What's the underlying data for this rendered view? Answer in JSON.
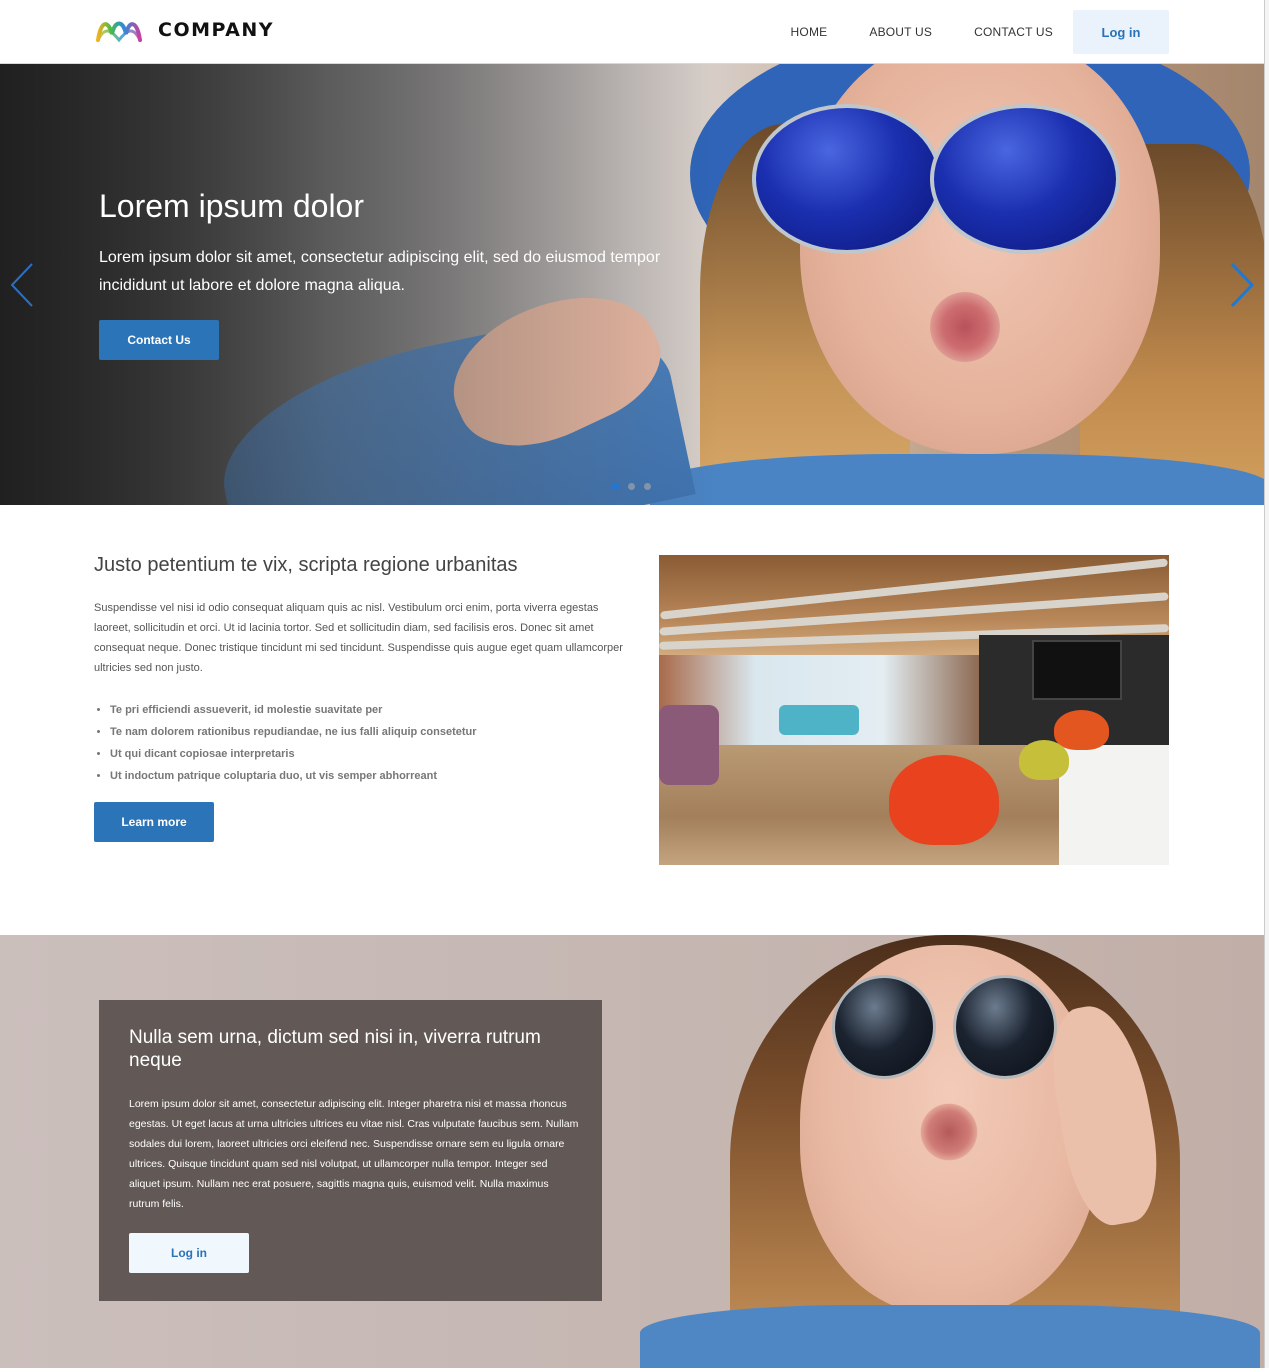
{
  "header": {
    "logo_text": "COMPANY",
    "nav": [
      "HOME",
      "ABOUT US",
      "CONTACT US"
    ],
    "login_label": "Log in"
  },
  "hero": {
    "title": "Lorem ipsum dolor",
    "text": "Lorem ipsum dolor sit amet, consectetur adipiscing elit, sed do eiusmod tempor incididunt ut labore et dolore magna aliqua.",
    "button_label": "Contact Us",
    "slide_count": 3,
    "active_slide": 1
  },
  "feature": {
    "title": "Justo petentium te vix, scripta regione urbanitas",
    "text": "Suspendisse vel nisi id odio consequat aliquam quis ac nisl. Vestibulum orci enim, porta viverra egestas laoreet, sollicitudin et orci. Ut id lacinia tortor. Sed et sollicitudin diam, sed facilisis eros. Donec sit amet consequat neque. Donec tristique tincidunt mi sed tincidunt. Suspendisse quis augue eget quam ullamcorper ultricies sed non justo.",
    "list": [
      "Te pri efficiendi assueverit, id molestie suavitate per",
      "Te nam dolorem rationibus repudiandae, ne ius falli aliquip consetetur",
      "Ut qui dicant copiosae interpretaris",
      "Ut indoctum patrique coluptaria duo, ut vis semper abhorreant"
    ],
    "button_label": "Learn more"
  },
  "banner": {
    "title": "Nulla sem urna, dictum sed nisi in, viverra rutrum neque",
    "text": "Lorem ipsum dolor sit amet, consectetur adipiscing elit. Integer pharetra nisi et massa rhoncus egestas. Ut eget lacus at urna ultricies ultrices eu vitae nisl. Cras vulputate faucibus sem. Nullam sodales dui lorem, laoreet ultricies orci eleifend nec. Suspendisse ornare sem eu ligula ornare ultrices. Quisque tincidunt quam sed nisl volutpat, ut ullamcorper nulla tempor. Integer sed aliquet ipsum. Nullam nec erat posuere, sagittis magna quis, euismod velit. Nulla maximus rutrum felis.",
    "button_label": "Log in"
  },
  "colors": {
    "primary": "#2c74b8",
    "login_bg": "#eaf3fb",
    "panel_bg": "#625956",
    "carousel_active": "#1e78d6"
  }
}
